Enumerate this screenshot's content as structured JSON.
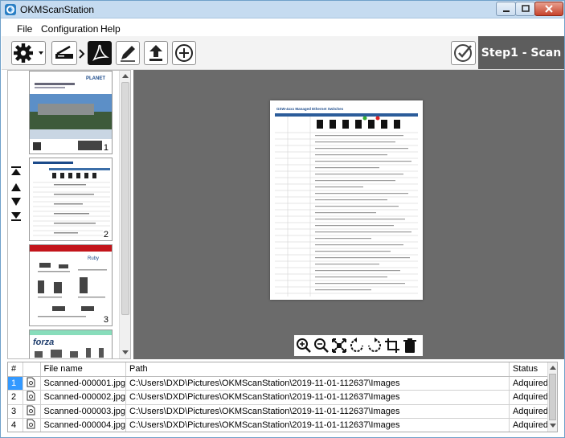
{
  "window": {
    "title": "OKMScanStation"
  },
  "menu": [
    "File",
    "Configuration",
    "Help"
  ],
  "toolbar": {
    "step_label": "Step1 - Scan"
  },
  "thumbnails": [
    {
      "number": "1"
    },
    {
      "number": "2"
    },
    {
      "number": "3"
    },
    {
      "number": ""
    }
  ],
  "table": {
    "headers": [
      "#",
      "",
      "File name",
      "Path",
      "Status"
    ],
    "rows": [
      {
        "num": "1",
        "file": "Scanned-000001.jpg",
        "path": "C:\\Users\\DXD\\Pictures\\OKMScanStation\\2019-11-01-112637\\Images",
        "status": "Adquired"
      },
      {
        "num": "2",
        "file": "Scanned-000002.jpg",
        "path": "C:\\Users\\DXD\\Pictures\\OKMScanStation\\2019-11-01-112637\\Images",
        "status": "Adquired"
      },
      {
        "num": "3",
        "file": "Scanned-000003.jpg",
        "path": "C:\\Users\\DXD\\Pictures\\OKMScanStation\\2019-11-01-112637\\Images",
        "status": "Adquired"
      },
      {
        "num": "4",
        "file": "Scanned-000004.jpg",
        "path": "C:\\Users\\DXD\\Pictures\\OKMScanStation\\2019-11-01-112637\\Images",
        "status": "Adquired"
      }
    ]
  },
  "preview": {
    "doc_title": "GSW-4xxx Managed Ethernet Switches"
  },
  "thumb_texts": {
    "t1_brand": "PLANET",
    "t3_brand": "Ruby",
    "t4_brand": "forza"
  },
  "icons": {
    "toolbar": [
      "gear-icon",
      "scanner-icon",
      "chevron-right-icon",
      "pdf-icon",
      "pencil-icon",
      "upload-icon",
      "add-icon",
      "check-icon"
    ],
    "nav": [
      "first-icon",
      "up-icon",
      "down-icon",
      "last-icon"
    ],
    "image": [
      "zoom-in-icon",
      "zoom-out-icon",
      "fit-icon",
      "rotate-left-icon",
      "rotate-right-icon",
      "crop-icon",
      "delete-icon"
    ]
  },
  "colors": {
    "titlebar": "#c5dbf0",
    "step_bg": "#5d5d5d",
    "preview_bg": "#6b6b6b",
    "selection": "#3399ff"
  }
}
